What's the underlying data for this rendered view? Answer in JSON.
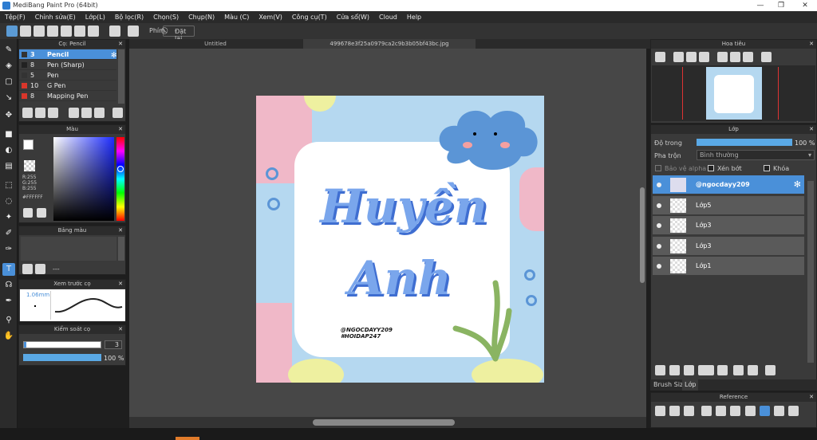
{
  "window": {
    "title": "MediBang Paint Pro (64bit)",
    "minimize": "—",
    "maximize": "❐",
    "close": "✕"
  },
  "menu": [
    "Tệp(F)",
    "Chỉnh sửa(E)",
    "Lớp(L)",
    "Bộ lọc(R)",
    "Chọn(S)",
    "Chụp(N)",
    "Màu (C)",
    "Xem(V)",
    "Công cụ(T)",
    "Cửa sổ(W)",
    "Cloud",
    "Help"
  ],
  "toolbar": {
    "phim_label": "Phím",
    "reset_label": "Đặt lại"
  },
  "brush_panel": {
    "title": "Cọ: Pencil",
    "items": [
      {
        "size": "3",
        "name": "Pencil",
        "color": "#333333"
      },
      {
        "size": "8",
        "name": "Pen (Sharp)",
        "color": "#222222"
      },
      {
        "size": "5",
        "name": "Pen",
        "color": "#333333"
      },
      {
        "size": "10",
        "name": "G Pen",
        "color": "#d9362b"
      },
      {
        "size": "8",
        "name": "Mapping Pen",
        "color": "#d9362b"
      }
    ]
  },
  "color_panel": {
    "title": "Màu",
    "r": "R:255",
    "g": "G:255",
    "b": "B:255",
    "hex": "#FFFFFF"
  },
  "palette_panel": {
    "title": "Bảng màu",
    "more": "---"
  },
  "preview_panel": {
    "title": "Xem trước cọ",
    "size": "1.06mm"
  },
  "brush_control": {
    "title": "Kiểm soát cọ",
    "size_value": "3",
    "opacity_value": "100 %"
  },
  "doc_tabs": [
    "Untitled",
    "499678e3f25a0979ca2c9b3b05bf43bc.jpg"
  ],
  "artwork": {
    "line1": "Huyền",
    "line2": "Anh",
    "credit1": "@NGOCDAYY209",
    "credit2": "#HOIDAP247"
  },
  "navigator": {
    "title": "Hoa tiêu"
  },
  "layers_panel": {
    "title": "Lớp",
    "opacity_label": "Độ trong",
    "opacity_value": "100 %",
    "blend_label": "Pha trộn",
    "blend_value": "Bình thường",
    "protect_alpha": "Bảo vệ alpha",
    "clip": "Xén bớt",
    "lock": "Khóa",
    "layers": [
      "@ngocdayy209",
      "Lớp5",
      "Lớp3",
      "Lớp3",
      "Lớp1"
    ]
  },
  "bottom_tabs": [
    "Brush Size",
    "Lớp"
  ],
  "reference": {
    "title": "Reference"
  }
}
